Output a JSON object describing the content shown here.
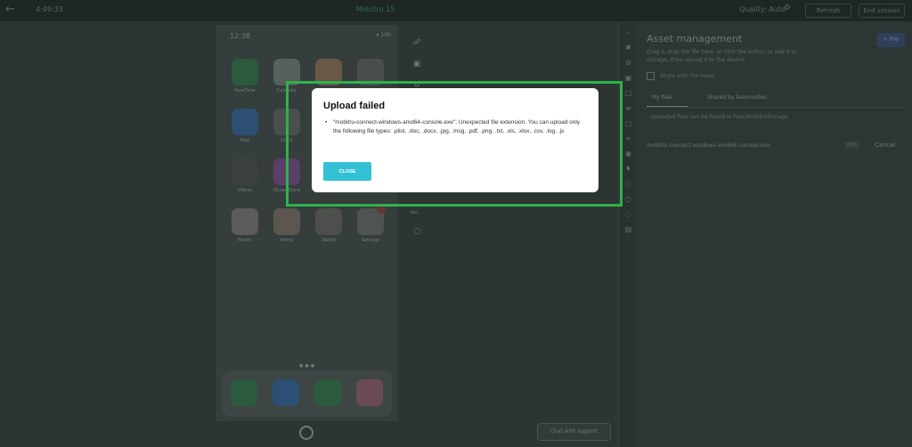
{
  "topbar": {
    "session_time": "4:49:33",
    "device_status": "Mobitru 15",
    "quality": "Quality: Auto",
    "refresh_label": "Refresh",
    "end_label": "End session"
  },
  "phone": {
    "time": "12:38",
    "status_icons": "▾ 100",
    "apps": [
      {
        "label": "FaceTime",
        "color": "#2b5a3c"
      },
      {
        "label": "Calendar",
        "color": "#58605e"
      },
      {
        "label": "Photos",
        "color": "#6a5847"
      },
      {
        "label": "Camera",
        "color": "#4a4f4e"
      },
      {
        "label": "Mail",
        "color": "#2d4f73"
      },
      {
        "label": "Clock",
        "color": "#4a4f4e"
      },
      {
        "label": "Notes",
        "color": "#6a6540"
      },
      {
        "label": "Reminders",
        "color": "#535958"
      },
      {
        "label": "Videos",
        "color": "#3b3f3e"
      },
      {
        "label": "iTunes Store",
        "color": "#5a3f6b"
      },
      {
        "label": "App Store",
        "color": "#2d5a7c"
      },
      {
        "label": "Books",
        "color": "#7a5a2a"
      },
      {
        "label": "Health",
        "color": "#5c5a5a"
      },
      {
        "label": "Home",
        "color": "#5c5550"
      },
      {
        "label": "Wallet",
        "color": "#4d4f4d"
      },
      {
        "label": "Settings",
        "color": "#4f5352"
      }
    ],
    "dock_colors": [
      "#2b5a3c",
      "#2d4f73",
      "#2b5a3c",
      "#6b4a55"
    ]
  },
  "tools": {
    "label": "Rec"
  },
  "panel": {
    "title": "Asset management",
    "description": "Drag & drop the file here, or click the button to add it to storage, then upload it to the device.",
    "file_button": "+ File",
    "share_label": "Share with the team",
    "tab_my_files": "My files",
    "tab_shared": "Shared by teammates",
    "hint": "Uploaded files can be found in Files/MobitruStorage",
    "file_name": "mobitru-connect-windows-amd64-console.exe",
    "file_size": "0MB",
    "cancel_label": "Cancel"
  },
  "chat_label": "Chat with support",
  "modal": {
    "title": "Upload failed",
    "message": "\"mobitru-connect-windows-amd64-console.exe\": Unexpected file extension. You can upload only the following file types: .plist, .doc, .docx, .jpg, .msg, .pdf, .png, .txt, .xls, .xlsx, .csv, .log, .js",
    "close_label": "CLOSE"
  },
  "colors": {
    "highlight": "#2db34a",
    "close_button": "#33c1d5"
  }
}
